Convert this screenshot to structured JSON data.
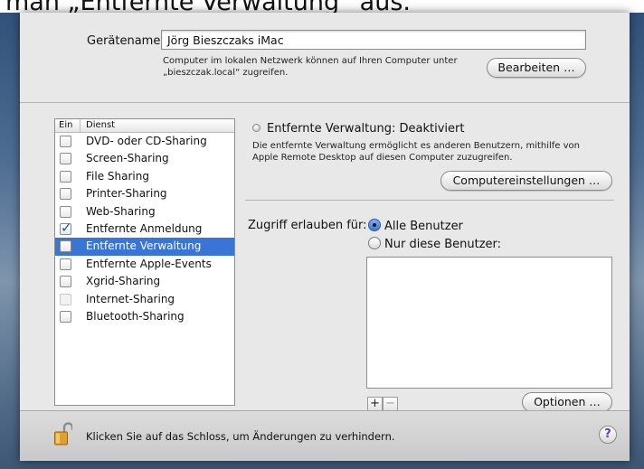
{
  "caption": {
    "text": "man „Entfernte Verwaltung“ aus."
  },
  "computer": {
    "name_label": "Gerätename:",
    "name_value": "Jörg Bieszczaks iMac",
    "hint_line1": "Computer im lokalen Netzwerk können auf Ihren Computer unter",
    "hint_line2": "„bieszczak.local“ zugreifen.",
    "edit_button": "Bearbeiten …"
  },
  "services": {
    "header_on": "Ein",
    "header_service": "Dienst",
    "items": [
      {
        "label": "DVD- oder CD-Sharing",
        "checked": false,
        "selected": false,
        "enabled": true
      },
      {
        "label": "Screen-Sharing",
        "checked": false,
        "selected": false,
        "enabled": true
      },
      {
        "label": "File Sharing",
        "checked": false,
        "selected": false,
        "enabled": true
      },
      {
        "label": "Printer-Sharing",
        "checked": false,
        "selected": false,
        "enabled": true
      },
      {
        "label": "Web-Sharing",
        "checked": false,
        "selected": false,
        "enabled": true
      },
      {
        "label": "Entfernte Anmeldung",
        "checked": true,
        "selected": false,
        "enabled": true
      },
      {
        "label": "Entfernte Verwaltung",
        "checked": false,
        "selected": true,
        "enabled": true
      },
      {
        "label": "Entfernte Apple-Events",
        "checked": false,
        "selected": false,
        "enabled": true
      },
      {
        "label": "Xgrid-Sharing",
        "checked": false,
        "selected": false,
        "enabled": true
      },
      {
        "label": "Internet-Sharing",
        "checked": false,
        "selected": false,
        "enabled": false
      },
      {
        "label": "Bluetooth-Sharing",
        "checked": false,
        "selected": false,
        "enabled": true
      }
    ]
  },
  "detail": {
    "status": "Entfernte Verwaltung: Deaktiviert",
    "description_line1": "Die entfernte Verwaltung ermöglicht es anderen Benutzern, mithilfe von",
    "description_line2": "Apple Remote Desktop auf diesen Computer zuzugreifen.",
    "computer_settings_button": "Computereinstellungen …",
    "access_label": "Zugriff erlauben für:",
    "radio_all": "Alle Benutzer",
    "radio_only": "Nur diese Benutzer:",
    "plus_label": "+",
    "minus_label": "−",
    "options_button": "Optionen …"
  },
  "footer": {
    "lock_text": "Klicken Sie auf das Schloss, um Änderungen zu verhindern.",
    "help_label": "?"
  },
  "colors": {
    "selection": "#3875d7",
    "panel": "#e8e8e8"
  }
}
